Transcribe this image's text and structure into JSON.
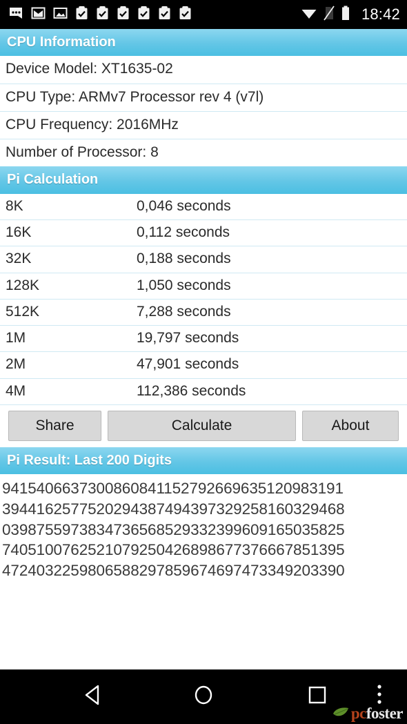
{
  "status_bar": {
    "time": "18:42",
    "left_icons": [
      "chat-bubble-icon",
      "gmail-icon",
      "photo-icon",
      "clipboard-check-icon",
      "clipboard-check-icon",
      "clipboard-check-icon",
      "clipboard-check-icon",
      "clipboard-check-icon",
      "clipboard-check-icon"
    ],
    "right_icons": [
      "wifi-icon",
      "no-sim-icon",
      "battery-icon"
    ]
  },
  "colors": {
    "header_bar": "#63c6e6",
    "header_text": "#ffffff",
    "row_divider": "#cfe9f3",
    "body_text": "#2a2a2a",
    "button_face": "#d8d8d8",
    "system_bar": "#000000",
    "watermark_pc": "#b5431c",
    "watermark_foster": "#e8e8e8",
    "watermark_leaf": "#5e8f2a"
  },
  "cpu_section": {
    "title": "CPU Information",
    "rows": [
      "Device Model: XT1635-02",
      "CPU Type: ARMv7 Processor rev 4 (v7l)",
      "CPU Frequency: 2016MHz",
      "Number of Processor: 8"
    ]
  },
  "pi_section": {
    "title": "Pi Calculation",
    "rows": [
      {
        "label": "8K",
        "value": "0,046 seconds"
      },
      {
        "label": "16K",
        "value": "0,112 seconds"
      },
      {
        "label": "32K",
        "value": "0,188 seconds"
      },
      {
        "label": "128K",
        "value": "1,050 seconds"
      },
      {
        "label": "512K",
        "value": "7,288 seconds"
      },
      {
        "label": "1M",
        "value": "19,797 seconds"
      },
      {
        "label": "2M",
        "value": "47,901 seconds"
      },
      {
        "label": "4M",
        "value": "112,386 seconds"
      }
    ]
  },
  "buttons": {
    "share": "Share",
    "calculate": "Calculate",
    "about": "About"
  },
  "result_section": {
    "title": "Pi Result: Last 200 Digits",
    "digit_lines": [
      "9415406637300860841152792669635120983191",
      "3944162577520294387494397329258160329468",
      "0398755973834736568529332399609165035825",
      "7405100762521079250426898677376667851395",
      "4724032259806588297859674697473349203390"
    ]
  },
  "nav_bar": {
    "back": "back-triangle-icon",
    "home": "home-circle-icon",
    "recent": "recent-square-icon",
    "menu": "overflow-menu-icon",
    "watermark_pc": "pc",
    "watermark_foster": "foster"
  }
}
